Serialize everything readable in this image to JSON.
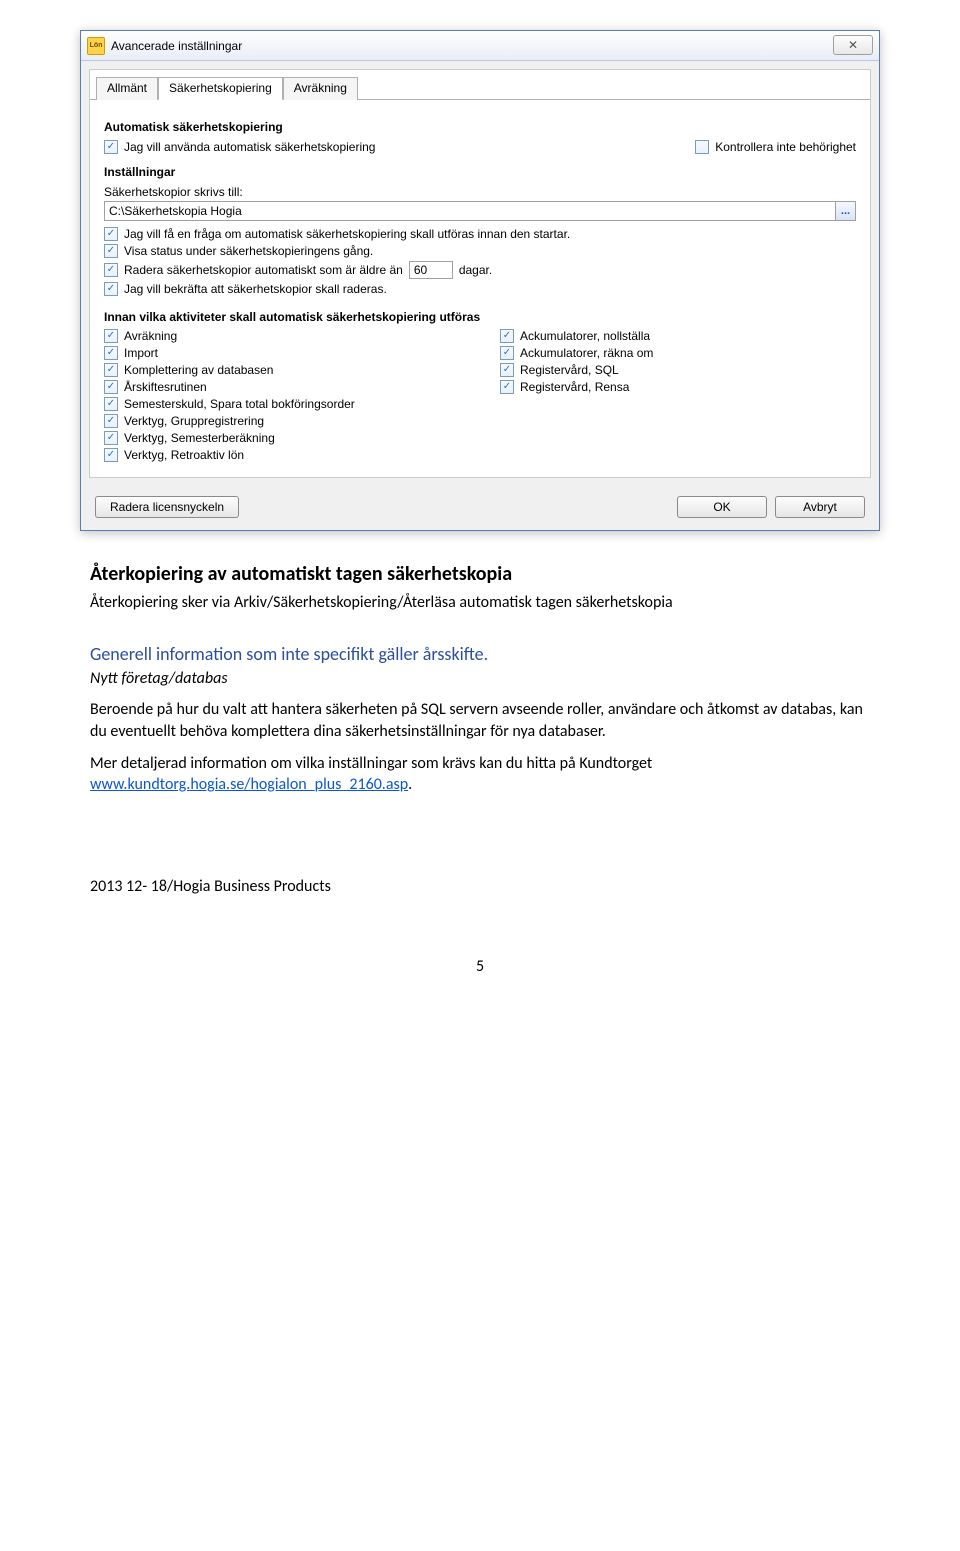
{
  "dialog": {
    "title": "Avancerade inställningar",
    "icon_label": "Lön",
    "close_glyph": "✕",
    "tabs": [
      "Allmänt",
      "Säkerhetskopiering",
      "Avräkning"
    ],
    "active_tab": 1,
    "sec_autobackup_head": "Automatisk säkerhetskopiering",
    "chk_use_autobackup": "Jag vill använda automatisk säkerhetskopiering",
    "chk_no_permcheck": "Kontrollera inte behörighet",
    "sec_settings_head": "Inställningar",
    "lbl_path": "Säkerhetskopior skrivs till:",
    "path_value": "C:\\Säkerhetskopia Hogia",
    "path_btn": "...",
    "chk_ask_before": "Jag vill få en fråga om automatisk säkerhetskopiering skall utföras innan den startar.",
    "chk_show_status": "Visa status under säkerhetskopieringens gång.",
    "chk_delete_older_prefix": "Radera säkerhetskopior automatiskt som är äldre än",
    "days_value": "60",
    "chk_delete_older_suffix": "dagar.",
    "chk_confirm_delete": "Jag vill bekräfta att säkerhetskopior skall raderas.",
    "sec_activities_head": "Innan vilka aktiviteter skall automatisk säkerhetskopiering utföras",
    "activities_left": [
      "Avräkning",
      "Import",
      "Komplettering av databasen",
      "Årskiftesrutinen",
      "Semesterskuld, Spara total bokföringsorder",
      "Verktyg, Gruppregistrering",
      "Verktyg, Semesterberäkning",
      "Verktyg, Retroaktiv lön"
    ],
    "activities_right": [
      "Ackumulatorer, nollställa",
      "Ackumulatorer, räkna om",
      "Registervård, SQL",
      "Registervård, Rensa"
    ],
    "btn_delete_license": "Radera licensnyckeln",
    "btn_ok": "OK",
    "btn_cancel": "Avbryt"
  },
  "doc": {
    "h_restore": "Återkopiering av automatiskt tagen säkerhetskopia",
    "p_restore": "Återkopiering sker via Arkiv/Säkerhetskopiering/Återläsa automatisk tagen säkerhetskopia",
    "h_general": "Generell information som inte specifikt gäller årsskifte.",
    "h_newdb": "Nytt företag/databas",
    "p_newdb": "Beroende på hur du valt att hantera säkerheten på SQL servern avseende roller, användare och åtkomst av databas, kan du eventuellt behöva komplettera dina säkerhetsinställningar för nya databaser.",
    "p_more_prefix": "Mer detaljerad information om vilka inställningar som krävs kan du hitta på Kundtorget ",
    "link_text": "www.kundtorg.hogia.se/hogialon_plus_2160.asp",
    "p_more_suffix": ".",
    "footer": "2013 12- 18/Hogia Business Products",
    "page_number": "5"
  }
}
